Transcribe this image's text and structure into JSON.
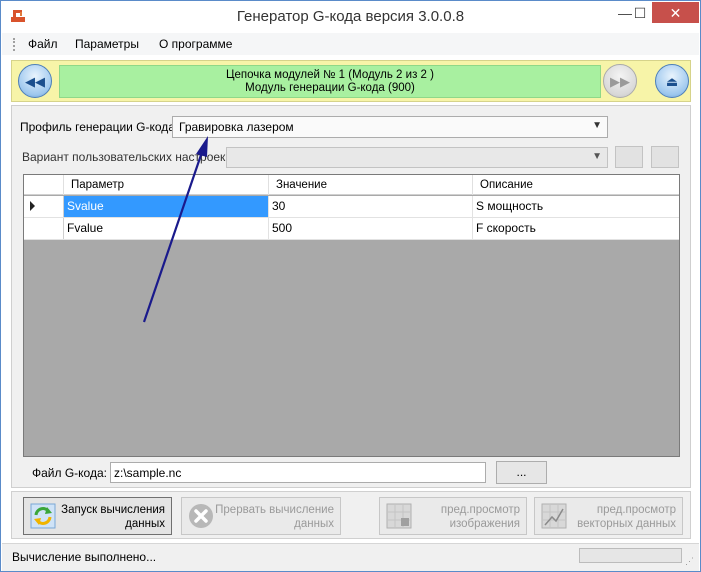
{
  "window": {
    "title": "Генератор G-кода версия 3.0.0.8",
    "minimize_glyph": "—",
    "maximize_glyph": "☐",
    "close_glyph": "✕"
  },
  "menu": {
    "items": [
      "Файл",
      "Параметры",
      "О программе"
    ]
  },
  "nav": {
    "chain_line1": "Цепочка модулей № 1 (Модуль 2 из 2 )",
    "chain_line2": "Модуль генерации G-кода (900)",
    "prev_glyph": "◀◀",
    "next_glyph": "▶▶",
    "eject_glyph": "⏏"
  },
  "profile": {
    "label": "Профиль генерации G-кода:",
    "value": "Гравировка лазером"
  },
  "variant": {
    "label": "Вариант пользовательских настроек:",
    "value": ""
  },
  "grid": {
    "columns": [
      "Параметр",
      "Значение",
      "Описание"
    ],
    "rows": [
      {
        "param": "Svalue",
        "value": "30",
        "desc": "S мощность"
      },
      {
        "param": "Fvalue",
        "value": "500",
        "desc": "F скорость"
      }
    ]
  },
  "file": {
    "label": "Файл G-кода:",
    "value": "z:\\sample.nc",
    "browse_label": "..."
  },
  "actions": {
    "start_line1": "Запуск вычисления",
    "start_line2": "данных",
    "stop_line1": "Прервать вычисление",
    "stop_line2": "данных",
    "preview_img_line1": "пред.просмотр",
    "preview_img_line2": "изображения",
    "preview_vec_line1": "пред.просмотр",
    "preview_vec_line2": "векторных данных"
  },
  "status": {
    "text": "Вычисление выполнено...",
    "progress_percent": 0
  },
  "colors": {
    "nav_bg": "#f7f4a8",
    "chain_bg": "#a8f0a0",
    "selection": "#3399ff",
    "close_button": "#c7504b",
    "annotation_arrow": "#1a1a8c"
  },
  "icons": {
    "app": "app-icon",
    "start": "recycle-icon",
    "stop": "stop-icon",
    "preview_image": "image-preview-icon",
    "preview_vector": "vector-preview-icon"
  }
}
